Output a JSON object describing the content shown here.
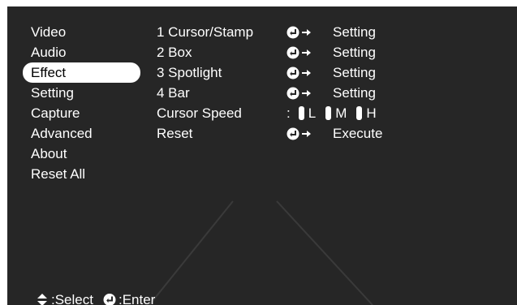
{
  "sidebar": {
    "items": [
      {
        "label": "Video"
      },
      {
        "label": "Audio"
      },
      {
        "label": "Effect",
        "selected": true
      },
      {
        "label": "Setting"
      },
      {
        "label": "Capture"
      },
      {
        "label": "Advanced"
      },
      {
        "label": "About"
      },
      {
        "label": "Reset All"
      }
    ]
  },
  "effect_menu": {
    "rows": [
      {
        "label": "1 Cursor/Stamp",
        "icon": "enter-arrow-icon",
        "value": "Setting"
      },
      {
        "label": "2 Box",
        "icon": "enter-arrow-icon",
        "value": "Setting"
      },
      {
        "label": "3 Spotlight",
        "icon": "enter-arrow-icon",
        "value": "Setting"
      },
      {
        "label": "4 Bar",
        "icon": "enter-arrow-icon",
        "value": "Setting"
      },
      {
        "label": "Reset",
        "icon": "enter-arrow-icon",
        "value": "Execute"
      }
    ],
    "cursor_speed": {
      "label": "Cursor Speed",
      "separator": ":",
      "options": [
        "L",
        "M",
        "H"
      ]
    }
  },
  "footer": {
    "select_label": ":Select",
    "enter_label": ":Enter",
    "select_icon": "up-down-triangle-icon",
    "enter_icon": "enter-icon"
  },
  "colors": {
    "background": "#262626",
    "text": "#ffffff",
    "highlight": "#ffffff",
    "highlight_text": "#000000"
  }
}
